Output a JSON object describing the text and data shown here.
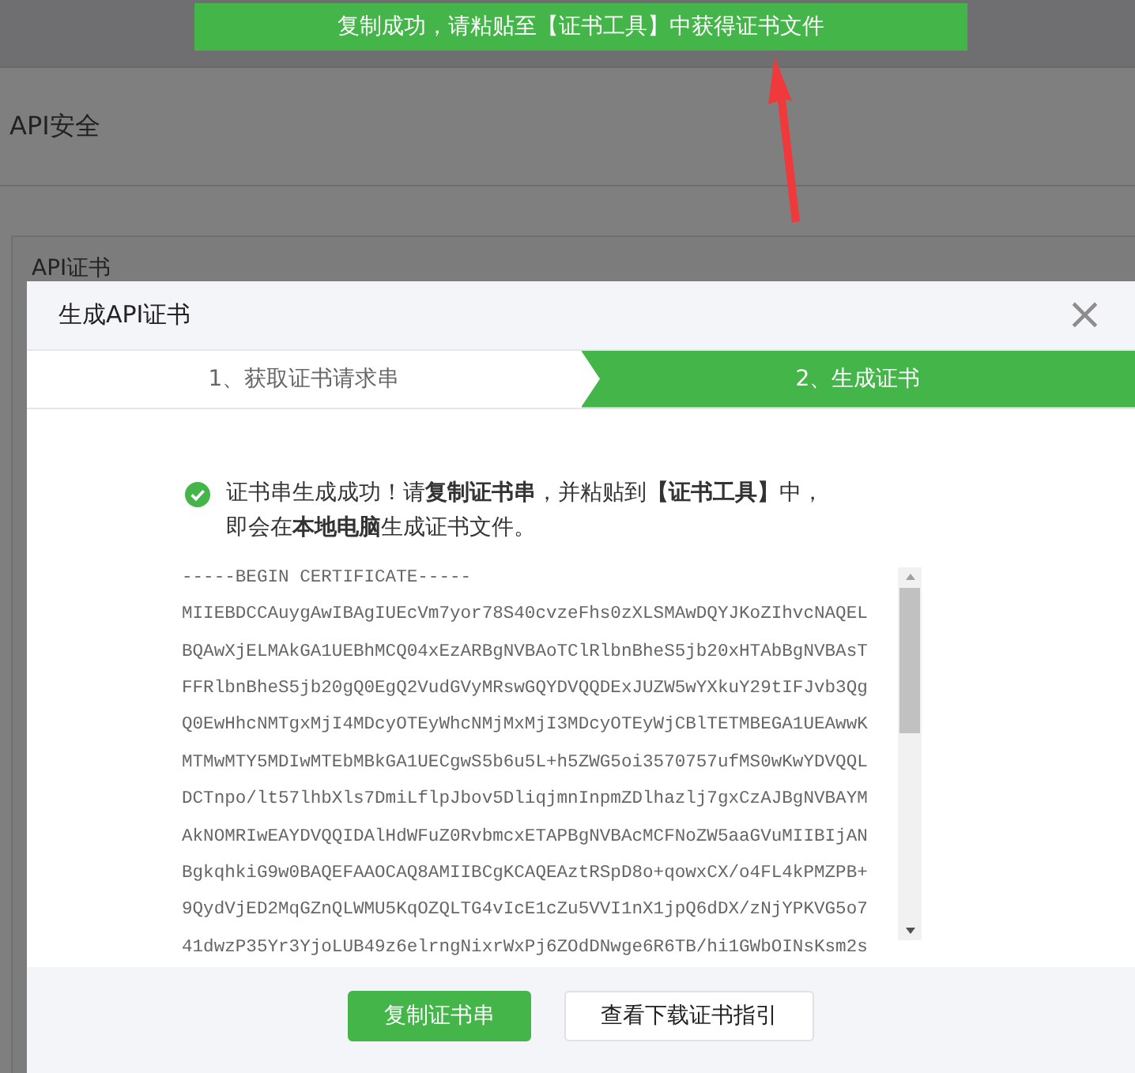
{
  "toast": {
    "text": "复制成功，请粘贴至【证书工具】中获得证书文件"
  },
  "page": {
    "title": "API安全",
    "panel_title": "API证书"
  },
  "dialog": {
    "title": "生成API证书",
    "close": "×",
    "steps": [
      {
        "label": "1、获取证书请求串",
        "selected": false
      },
      {
        "label": "2、生成证书",
        "selected": true
      }
    ],
    "message": [
      "证书串生成成功！请**复制证书串**，并粘贴到**【证书工具】**中，",
      "即会在**本地电脑**生成证书文件。"
    ],
    "certificate": [
      "-----BEGIN CERTIFICATE-----",
      "MIIEBDCCAuygAwIBAgIUEcVm7yor78S40cvzeFhs0zXLSMAwDQYJKoZIhvcNAQEL",
      "BQAwXjELMAkGA1UEBhMCQ04xEzARBgNVBAoTClRlbnBheS5jb20xHTAbBgNVBAsT",
      "FFRlbnBheS5jb20gQ0EgQ2VudGVyMRswGQYDVQQDExJUZW5wYXkuY29tIFJvb3Qg",
      "Q0EwHhcNMTgxMjI4MDcyOTEyWhcNMjMxMjI3MDcyOTEyWjCBlTETMBEGA1UEAwwK",
      "MTMwMTY5MDIwMTEbMBkGA1UECgwS5b6u5L+h5ZWG5oi3570757ufMS0wKwYDVQQL",
      "DCTnpo/lt57lhbXls7DmiLflpJbov5DliqjmnInpmZDlhazlj7gxCzAJBgNVBAYM",
      "AkNOMRIwEAYDVQQIDAlHdWFuZ0RvbmcxETAPBgNVBAcMCFNoZW5aaGVuMIIBIjAN",
      "BgkqhkiG9w0BAQEFAAOCAQ8AMIIBCgKCAQEAztRSpD8o+qowxCX/o4FL4kPMZPB+",
      "9QydVjED2MqGZnQLWMU5KqOZQLTG4vIcE1cZu5VVI1nX1jpQ6dDX/zNjYPKVG5o7",
      "41dwzP35Yr3YjoLUB49z6elrngNixrWxPj6ZOdDNwge6R6TB/hi1GWbOINsKsm2s"
    ],
    "buttons": [
      {
        "label": "复制证书串",
        "kind": "primary"
      },
      {
        "label": "查看下载证书指引",
        "kind": "default"
      }
    ]
  }
}
